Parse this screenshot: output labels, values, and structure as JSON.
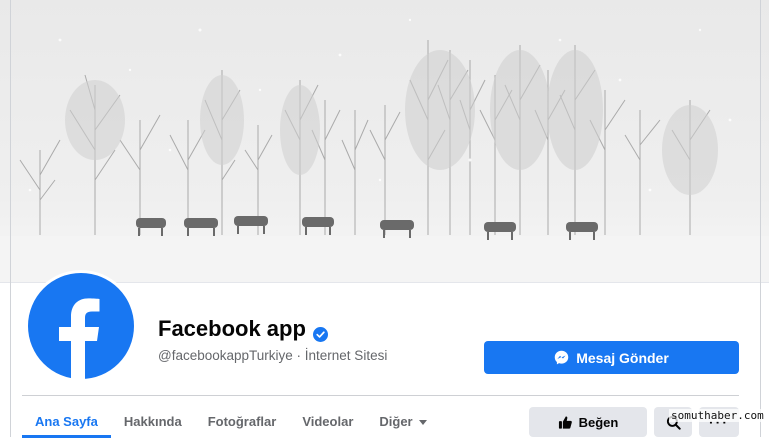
{
  "page": {
    "name": "Facebook app",
    "handle": "@facebookappTurkiye",
    "category": "İnternet Sitesi",
    "meta_separator": " · ",
    "verified": true
  },
  "cover": {
    "description_icon": "snowy-trees-horses-cover-photo"
  },
  "actions": {
    "message_label": "Mesaj Gönder",
    "like_label": "Beğen",
    "search_icon": "search-icon",
    "more_label": "···"
  },
  "tabs": [
    {
      "label": "Ana Sayfa",
      "active": true
    },
    {
      "label": "Hakkında",
      "active": false
    },
    {
      "label": "Fotoğraflar",
      "active": false
    },
    {
      "label": "Videolar",
      "active": false
    },
    {
      "label": "Diğer",
      "active": false,
      "dropdown": true
    }
  ],
  "watermark": "somuthaber.com",
  "colors": {
    "brand_blue": "#1877f2",
    "secondary_text": "#65676b",
    "button_gray": "#e4e6eb"
  }
}
